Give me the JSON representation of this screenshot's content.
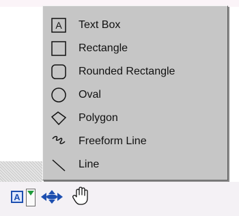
{
  "menu": {
    "items": [
      {
        "label": "Text Box",
        "icon": "text-box-icon"
      },
      {
        "label": "Rectangle",
        "icon": "rectangle-icon"
      },
      {
        "label": "Rounded Rectangle",
        "icon": "rounded-rectangle-icon"
      },
      {
        "label": "Oval",
        "icon": "oval-icon"
      },
      {
        "label": "Polygon",
        "icon": "polygon-icon"
      },
      {
        "label": "Freeform Line",
        "icon": "freeform-line-icon"
      },
      {
        "label": "Line",
        "icon": "line-icon"
      }
    ]
  },
  "toolbar": {
    "text_tool_glyph": "A",
    "dropdown_accent": "#1f9a3a",
    "move_tool_icon": "move-arrows-icon",
    "pan_tool_icon": "hand-icon",
    "accent_blue": "#1d4fb0"
  }
}
